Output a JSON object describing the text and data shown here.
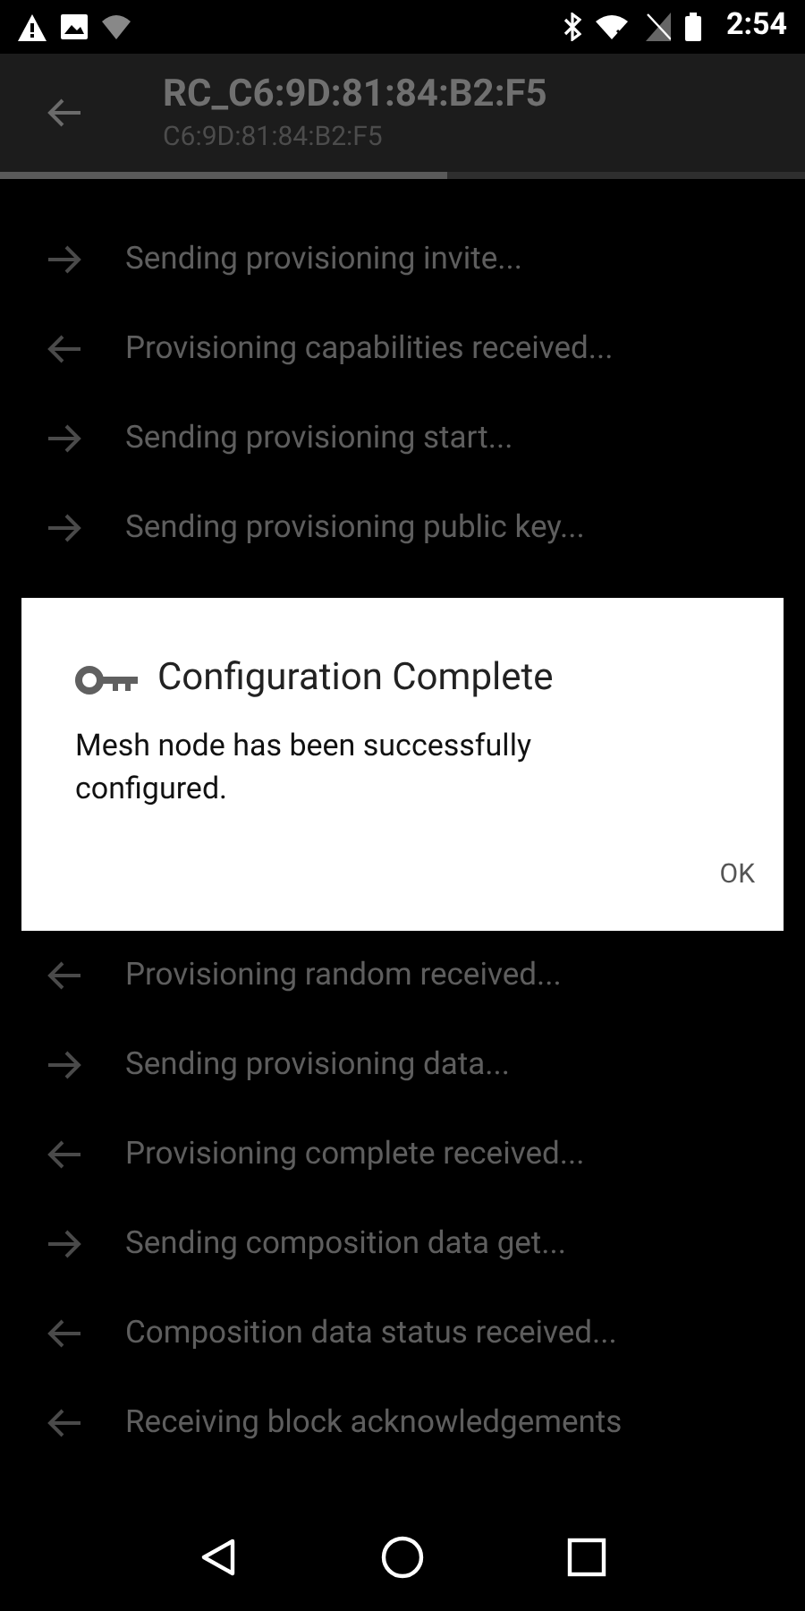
{
  "status_bar": {
    "time": "2:54"
  },
  "toolbar": {
    "title": "RC_C6:9D:81:84:B2:F5",
    "subtitle": "C6:9D:81:84:B2:F5",
    "progress": {
      "level": 0.555
    }
  },
  "log_before": [
    {
      "kind": "sent",
      "text": "Sending provisioning invite..."
    },
    {
      "kind": "received",
      "text": "Provisioning capabilities received..."
    },
    {
      "kind": "sent",
      "text": "Sending provisioning start..."
    },
    {
      "kind": "sent",
      "text": "Sending provisioning public key..."
    }
  ],
  "dialog": {
    "title": "Configuration Complete",
    "message": "Mesh node has been successfully configured.",
    "buttons": [
      "OK"
    ]
  },
  "log_after": [
    {
      "kind": "received",
      "text": "Provisioning random received..."
    },
    {
      "kind": "sent",
      "text": "Sending provisioning data..."
    },
    {
      "kind": "received",
      "text": "Provisioning complete received..."
    },
    {
      "kind": "sent",
      "text": "Sending composition data get..."
    },
    {
      "kind": "received",
      "text": "Composition data status received..."
    },
    {
      "kind": "received",
      "text": "Receiving block acknowledgements"
    }
  ]
}
